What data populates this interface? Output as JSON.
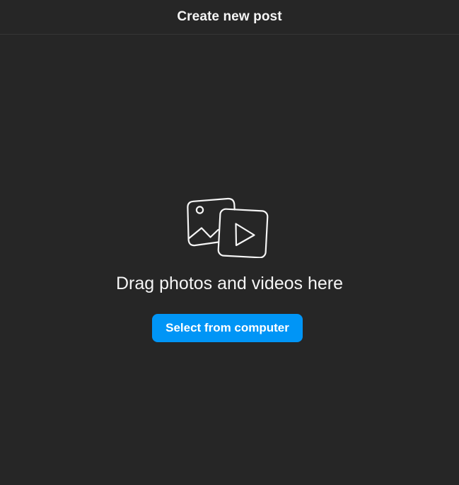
{
  "header": {
    "title": "Create new post"
  },
  "dropzone": {
    "icon": "photo-video-icon",
    "text": "Drag photos and videos here",
    "button_label": "Select from computer"
  },
  "colors": {
    "background": "#262626",
    "divider": "#363636",
    "text": "#f5f5f5",
    "accent": "#0095f6"
  }
}
